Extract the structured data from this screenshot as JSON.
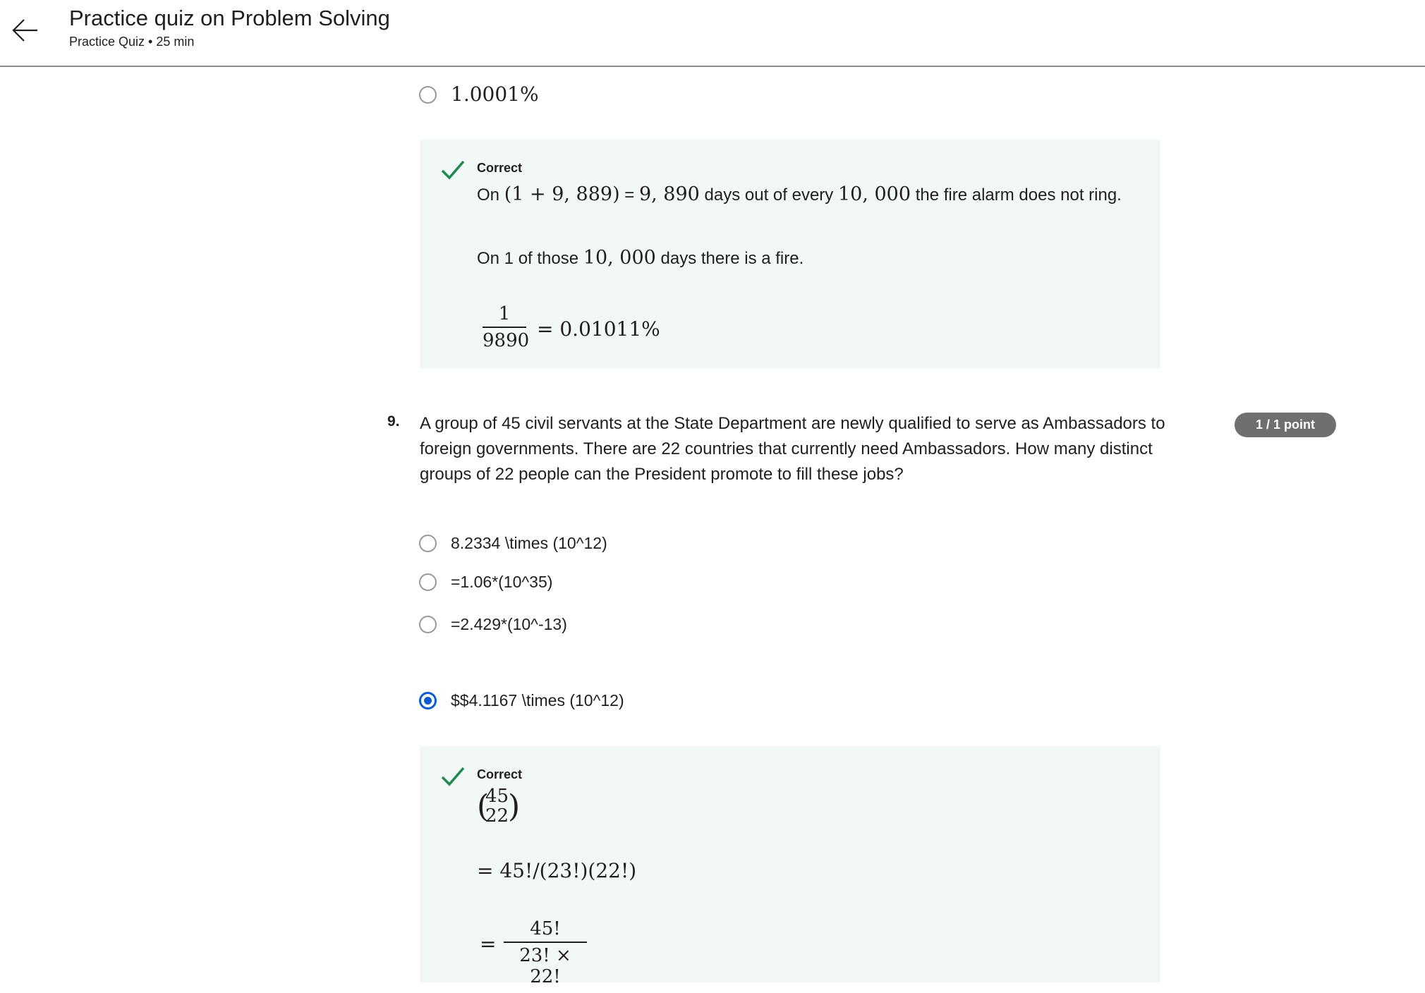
{
  "header": {
    "title": "Practice quiz on Problem Solving",
    "subtitle": "Practice Quiz • 25 min"
  },
  "prev_question": {
    "option_last": "1.0001%",
    "feedback": {
      "label": "Correct",
      "line1_pre": "On ",
      "line1_math1": "(1 + 9, 889)",
      "line1_mid": " = ",
      "line1_math2": "9, 890",
      "line1_mid2": " days out of every ",
      "line1_math3": "10, 000",
      "line1_post": " the fire alarm does not ring.",
      "line2_pre": "On 1 of those ",
      "line2_math": "10, 000",
      "line2_post": " days there is a fire.",
      "frac_num": "1",
      "frac_den": "9890",
      "frac_result": "= 0.01011%"
    }
  },
  "question": {
    "number": "9.",
    "text": "A group of 45 civil servants at the State Department are newly qualified to serve as Ambassadors to foreign governments. There are 22 countries that currently need Ambassadors. How many distinct groups of 22 people can the President promote to fill these jobs?",
    "points": "1 / 1 point",
    "options": [
      "8.2334 \\times (10^12)",
      "=1.06*(10^35)",
      "=2.429*(10^-13)",
      "$$4.1167 \\times (10^12)"
    ],
    "selected_index": 3,
    "feedback": {
      "label": "Correct",
      "binom_top": "45",
      "binom_bottom": "22",
      "line2": "= 45!/(23!)(22!)",
      "eq": "=",
      "frac_num": "45!",
      "frac_den": "23! × 22!"
    }
  },
  "colors": {
    "accent": "#0b5cd1",
    "success": "#1e8a4c",
    "feedback_bg": "#f2f8f5",
    "badge_bg": "#6f6f6f"
  },
  "icons": {
    "back": "arrow-left-icon",
    "correct": "checkmark-icon"
  }
}
